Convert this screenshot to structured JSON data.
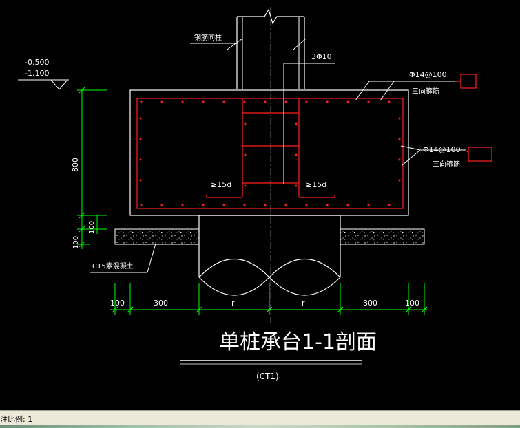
{
  "drawing": {
    "title": "单桩承台1-1剖面",
    "subtitle": "(CT1)",
    "elevations": [
      "-0.500",
      "-1.100"
    ],
    "labels": {
      "column": "钢筋同柱",
      "stirrup": "3Φ10",
      "rebar_top": "Φ14@100",
      "rebar_top_note": "三向箍筋",
      "rebar_side": "Φ14@100",
      "rebar_side_note": "三向箍筋",
      "anchor_left": "≥15d",
      "anchor_right": "≥15d",
      "concrete": "C15素混凝土"
    },
    "vertical_dims": [
      "800",
      "100",
      "100"
    ],
    "horizontal_dims": [
      "100",
      "300",
      "r",
      "r",
      "300",
      "100"
    ]
  },
  "status": {
    "scale_text": "注比例: 1"
  },
  "colors": {
    "background": "#000000",
    "linework": "#ffffff",
    "rebar": "#ff2020",
    "dimension": "#00ff00",
    "leader_box": "#ff2020",
    "status_bg": "#ece9d8"
  }
}
